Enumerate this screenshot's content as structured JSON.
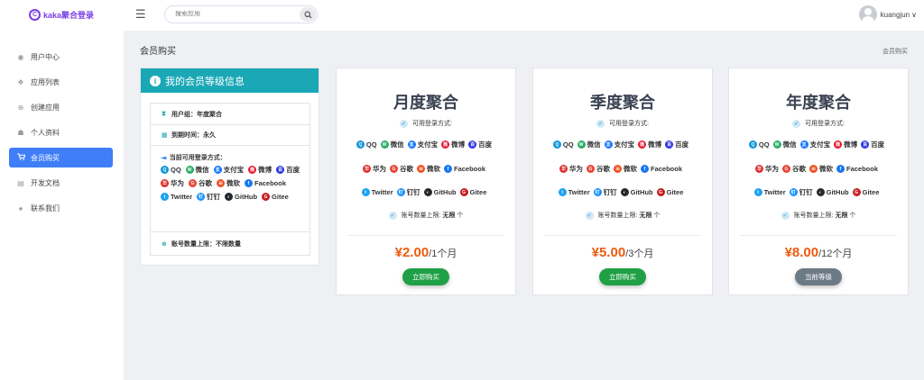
{
  "topbar": {
    "logo_letter": "C",
    "logo_text": "kaka聚合登录",
    "menu_icon": "hamburger-icon",
    "search_placeholder": "搜索应用",
    "search_icon": "search-icon",
    "user_name": "kuangjun",
    "user_caret": "∨"
  },
  "sidebar": {
    "items": [
      {
        "label": "用户中心",
        "icon": "user-circle-icon",
        "glyph": "◉"
      },
      {
        "label": "应用列表",
        "icon": "apps-icon",
        "glyph": "❖"
      },
      {
        "label": "创建应用",
        "icon": "plus-circle-icon",
        "glyph": "⊕"
      },
      {
        "label": "个人资料",
        "icon": "profile-icon",
        "glyph": "☗"
      },
      {
        "label": "会员购买",
        "icon": "cart-icon",
        "glyph": "🛒",
        "active": true
      },
      {
        "label": "开发文档",
        "icon": "document-icon",
        "glyph": "▤"
      },
      {
        "label": "联系我们",
        "icon": "bell-icon",
        "glyph": "♠"
      }
    ]
  },
  "main": {
    "title": "会员购买",
    "breadcrumb": "会员购买"
  },
  "info_card": {
    "header": "我的会员等级信息",
    "header_icon": "info-icon",
    "group_label": "用户组：年度聚合",
    "expire_label": "到期时间：永久",
    "methods_label": "当前可用登录方式：",
    "limit_label": "账号数量上限：不限数量"
  },
  "login_methods": [
    {
      "name": "QQ",
      "color": "#1296db",
      "glyph": "Q"
    },
    {
      "name": "微信",
      "color": "#2aae67",
      "glyph": "W"
    },
    {
      "name": "支付宝",
      "color": "#1677ff",
      "glyph": "支"
    },
    {
      "name": "微博",
      "color": "#e6162d",
      "glyph": "微"
    },
    {
      "name": "百度",
      "color": "#2932e1",
      "glyph": "百"
    },
    {
      "name": "华为",
      "color": "#e02c2c",
      "glyph": "华"
    },
    {
      "name": "谷歌",
      "color": "#ea4335",
      "glyph": "G"
    },
    {
      "name": "微软",
      "color": "#f25022",
      "glyph": "⊞"
    },
    {
      "name": "Facebook",
      "color": "#1877f2",
      "glyph": "f"
    },
    {
      "name": "Twitter",
      "color": "#1da1f2",
      "glyph": "t"
    },
    {
      "name": "钉钉",
      "color": "#1890ff",
      "glyph": "钉"
    },
    {
      "name": "GitHub",
      "color": "#24292e",
      "glyph": "◐"
    },
    {
      "name": "Gitee",
      "color": "#c71d23",
      "glyph": "G"
    }
  ],
  "plans": [
    {
      "name": "月度聚合",
      "login_label": "可用登录方式:",
      "limit_prefix": "账号数量上限:",
      "limit_value": "无限",
      "limit_unit": "个",
      "currency": "¥",
      "price": "2.00",
      "period": "/1个月",
      "button": "立即购买",
      "button_style": "green"
    },
    {
      "name": "季度聚合",
      "login_label": "可用登录方式:",
      "limit_prefix": "账号数量上限:",
      "limit_value": "无限",
      "limit_unit": "个",
      "currency": "¥",
      "price": "5.00",
      "period": "/3个月",
      "button": "立即购买",
      "button_style": "green"
    },
    {
      "name": "年度聚合",
      "login_label": "可用登录方式:",
      "limit_prefix": "账号数量上限:",
      "limit_value": "无限",
      "limit_unit": "个",
      "currency": "¥",
      "price": "8.00",
      "period": "/12个月",
      "button": "当前等级",
      "button_style": "gray"
    }
  ],
  "colors": {
    "accent": "#3f7ef8",
    "info_header": "#1ba8b6",
    "price": "#ee5a0e",
    "buy_button": "#1fa046",
    "current_button": "#6c7a86"
  }
}
